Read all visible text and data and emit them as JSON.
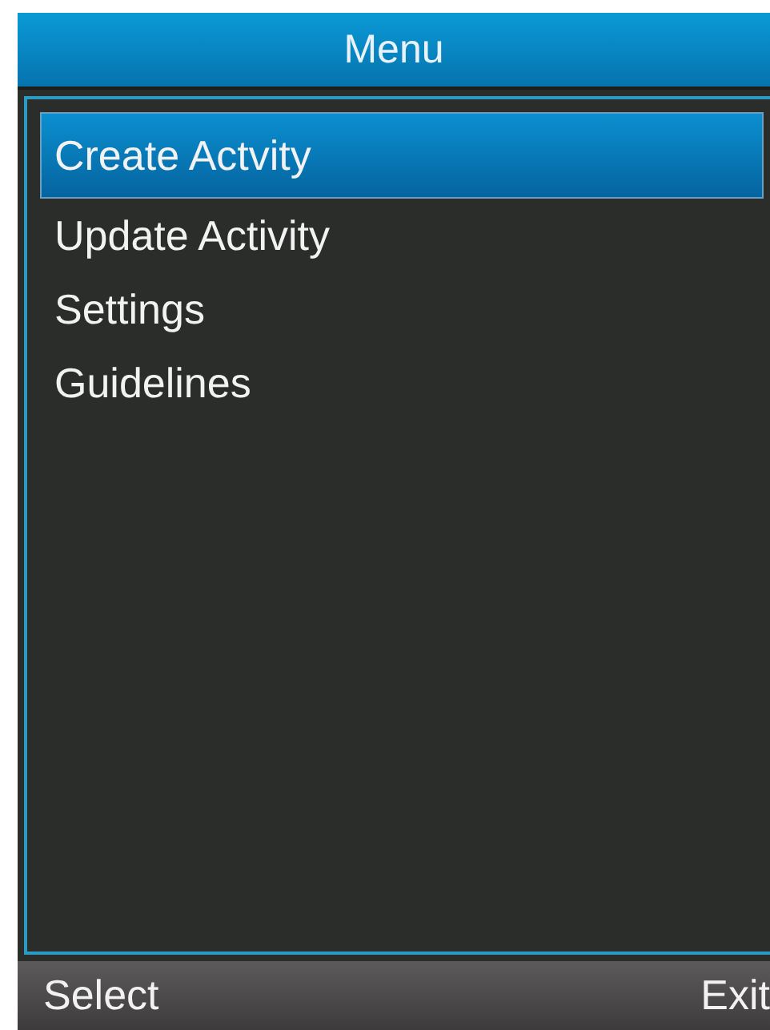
{
  "header": {
    "title": "Menu"
  },
  "menu": [
    {
      "label": "Create Actvity",
      "selected": true
    },
    {
      "label": "Update Activity",
      "selected": false
    },
    {
      "label": "Settings",
      "selected": false
    },
    {
      "label": "Guidelines",
      "selected": false
    }
  ],
  "softkeys": {
    "left": "Select",
    "right": "Exit"
  }
}
